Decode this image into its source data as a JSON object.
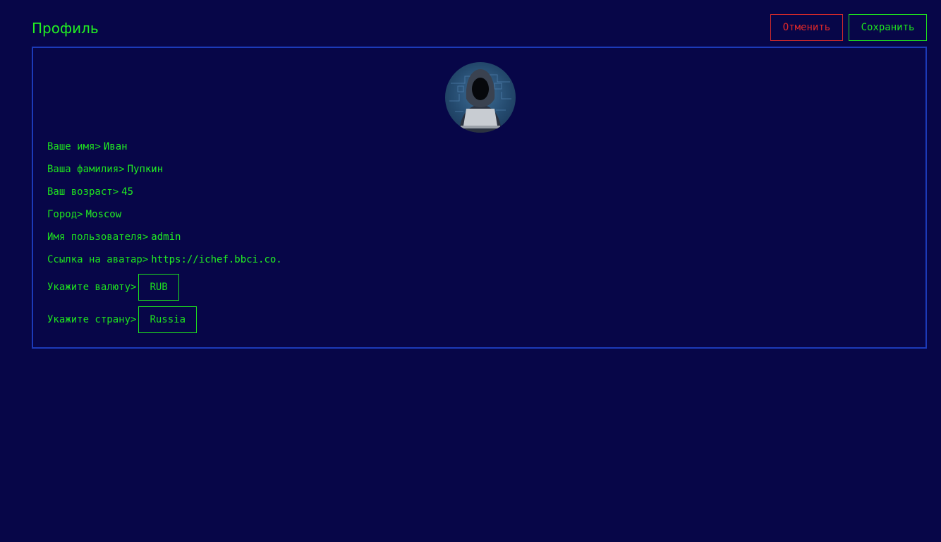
{
  "header": {
    "title": "Профиль",
    "cancel_label": "Отменить",
    "save_label": "Сохранить"
  },
  "colors": {
    "background": "#070648",
    "accent_green": "#1ee21e",
    "cancel_red": "#e02828",
    "card_border": "#1c3ab8"
  },
  "profile": {
    "avatar_icon": "hooded-hacker-avatar",
    "prompt": ">",
    "fields": [
      {
        "label": "Ваше имя",
        "value": "Иван"
      },
      {
        "label": "Ваша фамилия",
        "value": "Пупкин"
      },
      {
        "label": "Ваш возраст",
        "value": "45"
      },
      {
        "label": "Город",
        "value": "Moscow"
      },
      {
        "label": "Имя пользователя",
        "value": "admin"
      },
      {
        "label": "Ссылка на аватар",
        "value": "https://ichef.bbci.co."
      }
    ],
    "currency": {
      "label": "Укажите валюту",
      "value": "RUB"
    },
    "country": {
      "label": "Укажите страну",
      "value": "Russia"
    }
  }
}
